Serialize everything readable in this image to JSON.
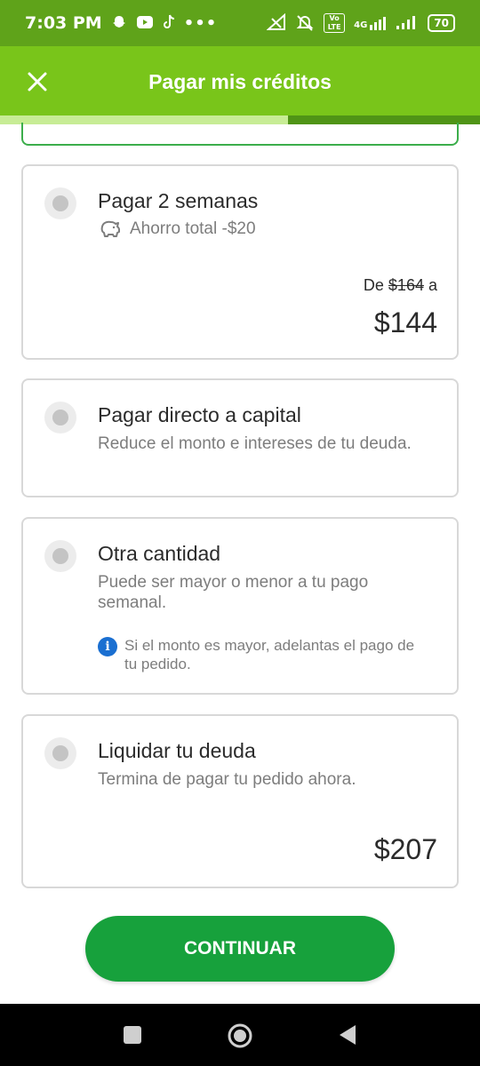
{
  "status_bar": {
    "time": "7:03 PM",
    "left_icons": [
      "snapchat-icon",
      "youtube-icon",
      "tiktok-icon",
      "more-dots-icon"
    ],
    "right_icons": [
      "signal-icon",
      "mute-icon",
      "volte-icon",
      "4g-signal-icon",
      "signal-bars-icon",
      "battery-icon"
    ],
    "network_label": "4G",
    "volte_label": "Vo LTE",
    "battery": "70"
  },
  "header": {
    "title": "Pagar mis créditos",
    "close_icon": "close-icon",
    "progress": 0.6,
    "colors": {
      "bar": "#79c51a",
      "status": "#5fa31a",
      "progress_fill": "#c7ec95",
      "progress_track": "#4f9416"
    }
  },
  "options": [
    {
      "title": "Pagar 2 semanas",
      "savings_icon": "piggy-bank-icon",
      "savings": "Ahorro total -$20",
      "from_prefix": "De",
      "old_amount": "$164",
      "from_suffix": "a",
      "amount": "$144"
    },
    {
      "title": "Pagar directo a capital",
      "subtitle": "Reduce el monto e intereses de tu deuda."
    },
    {
      "title": "Otra cantidad",
      "subtitle": "Puede ser mayor o menor a tu pago semanal.",
      "info_icon": "info-icon",
      "info": "Si el monto es mayor, adelantas el pago de tu pedido."
    },
    {
      "title": "Liquidar tu deuda",
      "subtitle": "Termina de pagar tu pedido ahora.",
      "amount": "$207"
    }
  ],
  "continue_button": {
    "label": "CONTINUAR",
    "color": "#17a13c"
  },
  "nav_bar": {
    "buttons": [
      "recent-apps-icon",
      "home-icon",
      "back-icon"
    ]
  }
}
